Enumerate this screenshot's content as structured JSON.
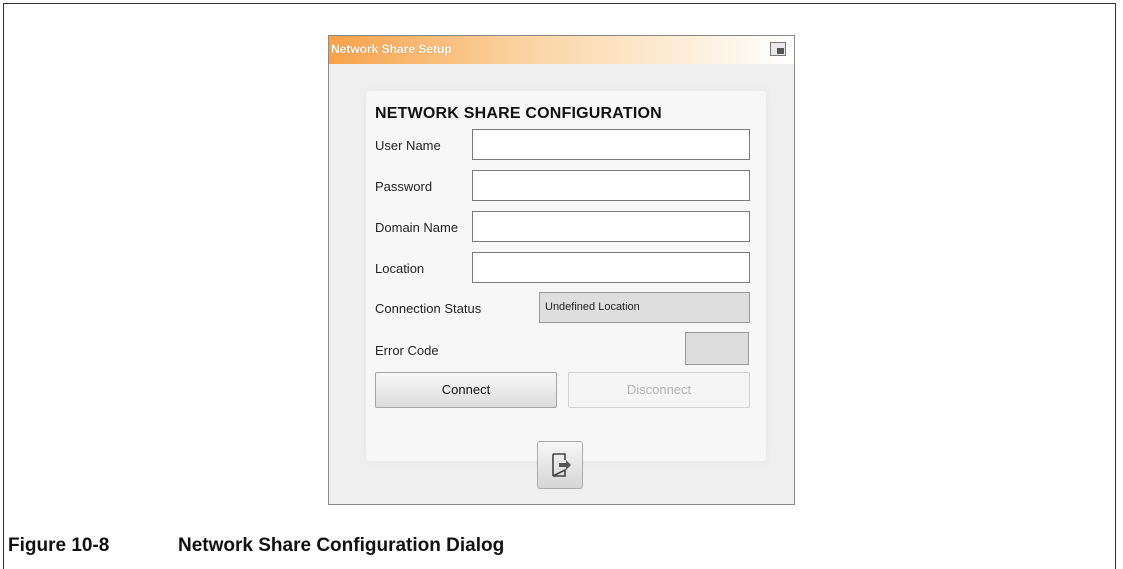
{
  "dialog": {
    "title": "Network Share Setup",
    "heading": "NETWORK SHARE CONFIGURATION",
    "fields": {
      "user_name_label": "User Name",
      "user_name_value": "",
      "password_label": "Password",
      "password_value": "",
      "domain_name_label": "Domain Name",
      "domain_name_value": "",
      "location_label": "Location",
      "location_value": ""
    },
    "connection_status_label": "Connection Status",
    "connection_status_value": "Undefined Location",
    "error_code_label": "Error Code",
    "error_code_value": "",
    "connect_label": "Connect",
    "disconnect_label": "Disconnect",
    "icons": {
      "restore": "restore-window-icon",
      "exit": "exit-door-icon"
    }
  },
  "caption": {
    "number": "Figure 10-8",
    "text": "Network Share Configuration Dialog"
  },
  "colors": {
    "title_gradient_start": "#f7a24a",
    "disabled_text": "#b5b5b5"
  }
}
